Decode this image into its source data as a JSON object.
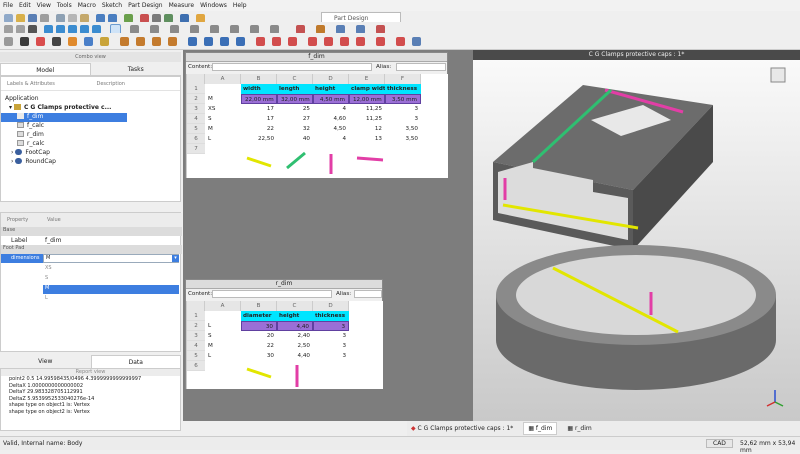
{
  "menu": [
    "File",
    "Edit",
    "View",
    "Tools",
    "Macro",
    "Sketch",
    "Part Design",
    "Measure",
    "Windows",
    "Help"
  ],
  "workbench": "Part Design",
  "combo": {
    "title": "Combo view",
    "tabs": [
      "Model",
      "Tasks"
    ],
    "tree_headers": [
      "Labels & Attributes",
      "Description"
    ],
    "application": "Application",
    "items": [
      "C G Clamps protective c...",
      "f_dim",
      "f_calc",
      "r_dim",
      "r_calc",
      "FootCap",
      "RoundCap"
    ]
  },
  "property": {
    "headers": [
      "Property",
      "Value"
    ],
    "group_base": "Base",
    "label_key": "Label",
    "label_val": "f_dim",
    "group_foot": "Foot Pad",
    "dim_key": "dimensions",
    "dim_val": "M",
    "options": [
      "XS",
      "S",
      "M",
      "L"
    ]
  },
  "report": {
    "tabs": [
      "View",
      "Data"
    ],
    "title": "Report view",
    "lines": [
      "point2 0.5   14.99598435/0496    4.3999999999999997",
      "DeltaX 1.0000000000000002",
      "DeltaY 29.983328705112991",
      "DeltaZ 5.9539952533040276e-14",
      "shape type on object1 is: Vertex",
      "shape type on object2 is: Vertex"
    ]
  },
  "status": {
    "left": "Valid, Internal name: Body",
    "cad": "CAD",
    "dims": "52,62 mm x 53,94 mm"
  },
  "view3d_title": "C G Clamps protective caps : 1*",
  "bottom_tabs": [
    "C G Clamps protective caps : 1*",
    "f_dim",
    "r_dim"
  ],
  "sheet1": {
    "title": "f_dim",
    "content_label": "Content:",
    "alias_label": "Alias:",
    "cols": [
      "A",
      "B",
      "C",
      "D",
      "E",
      "F"
    ],
    "header": [
      "width",
      "length",
      "height",
      "clamp width",
      "thickness"
    ],
    "rows": [
      [
        "M",
        "22,00 mm",
        "32,00 mm",
        "4,50 mm",
        "12,00 mm",
        "3,50 mm"
      ],
      [
        "XS",
        "17",
        "25",
        "4",
        "11,25",
        "3"
      ],
      [
        "S",
        "17",
        "27",
        "4,60",
        "11,25",
        "3"
      ],
      [
        "M",
        "22",
        "32",
        "4,50",
        "12",
        "3,50"
      ],
      [
        "L",
        "22,50",
        "40",
        "4",
        "13",
        "3,50"
      ]
    ]
  },
  "sheet2": {
    "title": "r_dim",
    "content_label": "Content:",
    "alias_label": "Alias:",
    "cols": [
      "A",
      "B",
      "C",
      "D"
    ],
    "header": [
      "diameter",
      "height",
      "thickness"
    ],
    "rows": [
      [
        "L",
        "30",
        "4,40",
        "3"
      ],
      [
        "S",
        "20",
        "2,40",
        "3"
      ],
      [
        "M",
        "22",
        "2,50",
        "3"
      ],
      [
        "L",
        "30",
        "4,40",
        "3"
      ]
    ]
  },
  "colors": {
    "cyan": "#00e5ff",
    "purple": "#9b6fd6",
    "yellow": "#e2e600",
    "green": "#2fbf71",
    "magenta": "#e23ea6",
    "accent": "#2d7dd8"
  }
}
